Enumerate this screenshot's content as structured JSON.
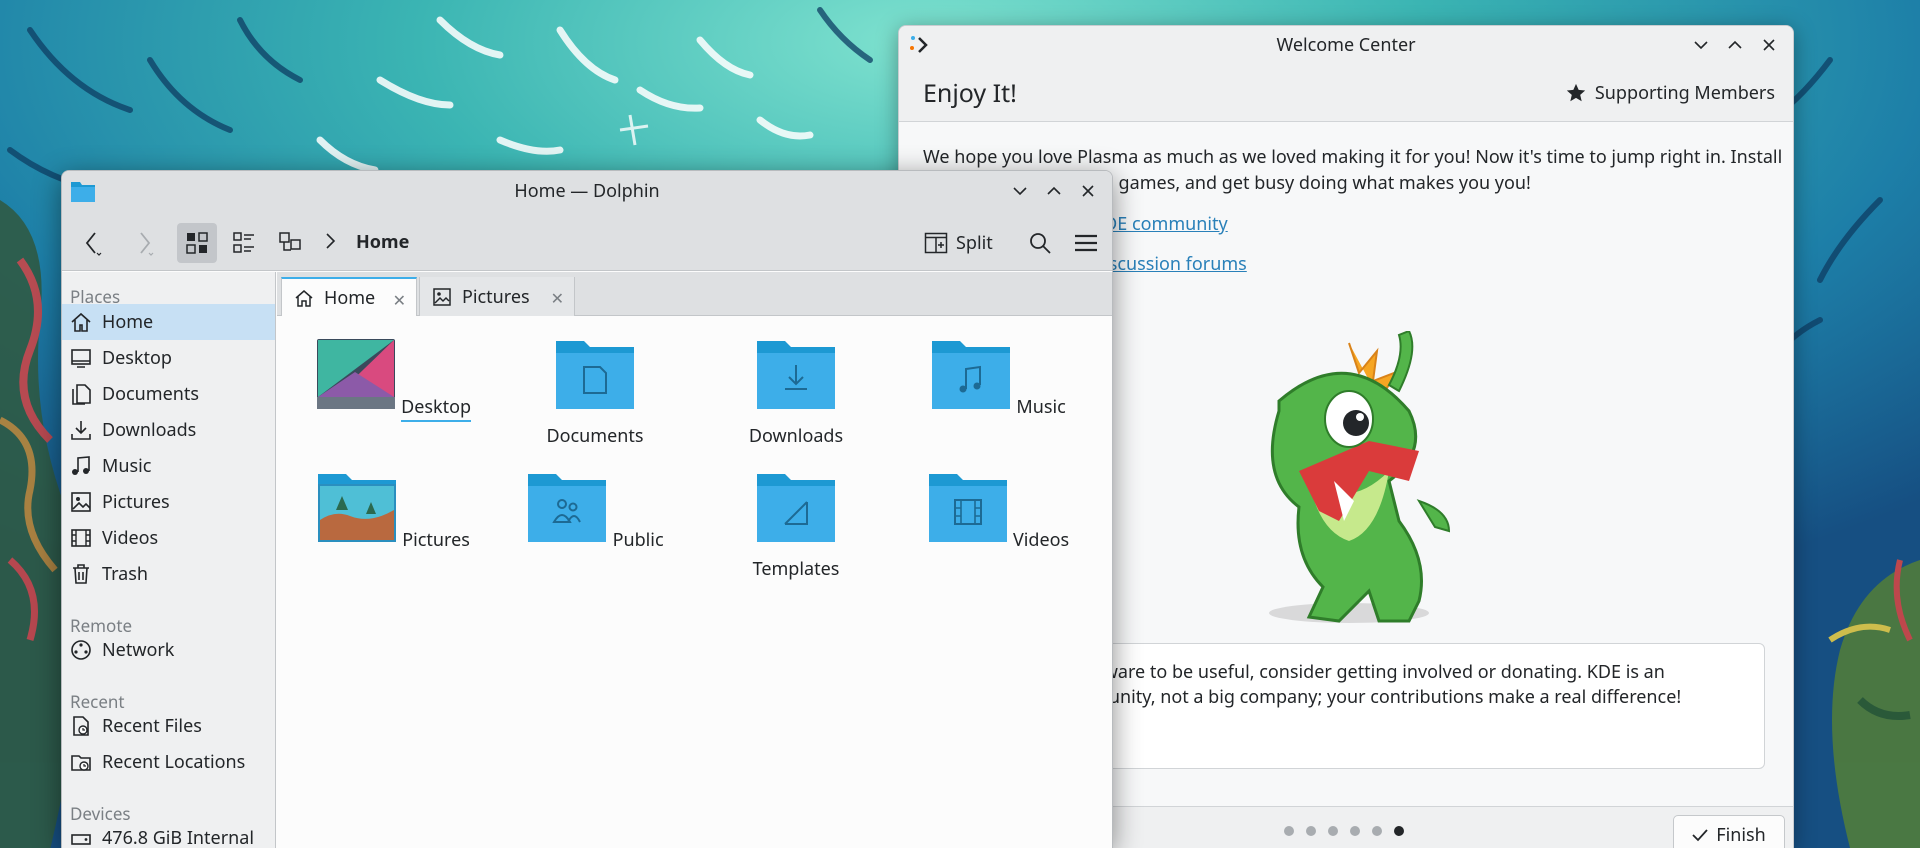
{
  "welcome_center": {
    "title": "Welcome Center",
    "heading": "Enjoy It!",
    "supporting_members": "Supporting Members",
    "intro": "We hope you love Plasma as much as we loved making it for you! Now it's time to jump right in. Install your favorite apps and games, and get busy doing what makes you you!",
    "links": [
      "KDE community",
      "discussion forums"
    ],
    "card_text": "If you find KDE software to be useful, consider getting involved or donating. KDE is an international community, not a big company; your contributions make a real difference!",
    "finish": "Finish",
    "pages": 6,
    "current_page": 6
  },
  "dolphin": {
    "title": "Home — Dolphin",
    "breadcrumb": "Home",
    "split_label": "Split",
    "tabs": [
      {
        "label": "Home",
        "icon": "home-icon"
      },
      {
        "label": "Pictures",
        "icon": "image-icon"
      }
    ],
    "sidebar": {
      "places_label": "Places",
      "places": [
        {
          "label": "Home",
          "icon": "home-icon"
        },
        {
          "label": "Desktop",
          "icon": "desktop-icon"
        },
        {
          "label": "Documents",
          "icon": "documents-icon"
        },
        {
          "label": "Downloads",
          "icon": "downloads-icon"
        },
        {
          "label": "Music",
          "icon": "music-icon"
        },
        {
          "label": "Pictures",
          "icon": "pictures-icon"
        },
        {
          "label": "Videos",
          "icon": "videos-icon"
        },
        {
          "label": "Trash",
          "icon": "trash-icon"
        }
      ],
      "remote_label": "Remote",
      "remote": [
        {
          "label": "Network",
          "icon": "network-icon"
        }
      ],
      "recent_label": "Recent",
      "recent": [
        {
          "label": "Recent Files",
          "icon": "recent-files-icon"
        },
        {
          "label": "Recent Locations",
          "icon": "recent-locations-icon"
        }
      ],
      "devices_label": "Devices",
      "devices": [
        {
          "label": "476.8 GiB Internal",
          "icon": "drive-icon"
        }
      ]
    },
    "files": [
      {
        "name": "Desktop",
        "icon": "desktop-folder-icon"
      },
      {
        "name": "Documents",
        "icon": "documents-folder-icon"
      },
      {
        "name": "Downloads",
        "icon": "downloads-folder-icon"
      },
      {
        "name": "Music",
        "icon": "music-folder-icon"
      },
      {
        "name": "Pictures",
        "icon": "pictures-folder-icon"
      },
      {
        "name": "Public",
        "icon": "public-folder-icon"
      },
      {
        "name": "Templates",
        "icon": "templates-folder-icon"
      },
      {
        "name": "Videos",
        "icon": "videos-folder-icon"
      }
    ]
  },
  "colors": {
    "accent": "#3daee9",
    "folder": "#3daee9",
    "folder_dark": "#1d99d3",
    "link": "#2980b9",
    "selection": "#c7e0f4"
  }
}
